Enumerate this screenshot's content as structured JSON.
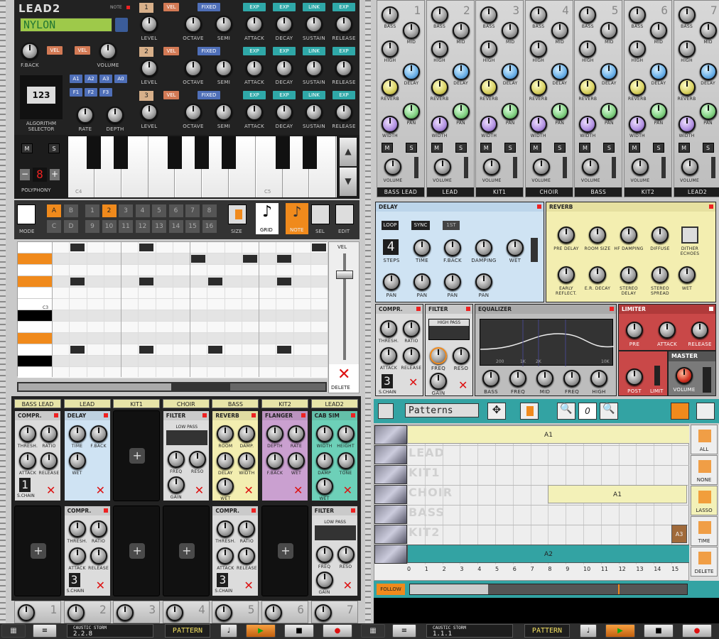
{
  "synth": {
    "name": "LEAD2",
    "note_label": "NOTE",
    "preset": "NYLON",
    "fback": "F.BACK",
    "vel": "VEL",
    "volume": "VOLUME",
    "algorithm": "ALGORITHM SELECTOR",
    "algo_display": "123",
    "rate": "RATE",
    "depth": "DEPTH",
    "lfo_buttons": [
      "A1",
      "A2",
      "A3",
      "A0",
      "F1",
      "F2",
      "F3"
    ],
    "operators": [
      {
        "num": "1"
      },
      {
        "num": "2"
      },
      {
        "num": "3"
      }
    ],
    "op_labels": {
      "level": "LEVEL",
      "octave": "OCTAVE",
      "semi": "SEMI",
      "attack": "ATTACK",
      "decay": "DECAY",
      "sustain": "SUSTAIN",
      "release": "RELEASE",
      "vel": "VEL",
      "fixed": "FIXED",
      "exp": "EXP",
      "link": "LINK"
    },
    "m": "M",
    "s": "S",
    "polyphony": "POLYPHONY",
    "poly_value": "8",
    "c4": "C4",
    "c5": "C5"
  },
  "pattern": {
    "banks": [
      "A",
      "B",
      "C",
      "D"
    ],
    "steps": [
      "1",
      "2",
      "3",
      "4",
      "5",
      "6",
      "7",
      "8",
      "9",
      "10",
      "11",
      "12",
      "13",
      "14",
      "15",
      "16"
    ],
    "size": "SIZE",
    "grid": "GRID",
    "note": "NOTE",
    "sel": "SEL",
    "edit": "EDIT",
    "mode": "MODE",
    "vel": "VEL",
    "c3": "C3",
    "delete": "DELETE"
  },
  "channels": [
    "BASS LEAD",
    "LEAD",
    "KIT1",
    "CHOIR",
    "BASS",
    "KIT2",
    "LEAD2"
  ],
  "fx_row1": [
    {
      "title": "COMPR.",
      "k": [
        "THRESH.",
        "RATIO",
        "ATTACK",
        "RELEASE"
      ],
      "extra": "S.CHAIN",
      "val": "1"
    },
    {
      "title": "DELAY",
      "k": [
        "TIME",
        "F.BACK",
        "WET"
      ]
    },
    {
      "title": ""
    },
    {
      "title": "FILTER",
      "mode": "LOW PASS",
      "k": [
        "FREQ",
        "RESO",
        "GAIN"
      ]
    },
    {
      "title": "REVERB",
      "k": [
        "ROOM",
        "DAMP.",
        "DELAY",
        "WIDTH",
        "WET"
      ]
    },
    {
      "title": "FLANGER",
      "k": [
        "DEPTH",
        "RATE",
        "F.BACK",
        "WET"
      ]
    },
    {
      "title": "CAB SIM",
      "k": [
        "WIDTH",
        "HEIGHT",
        "DAMP",
        "TONE",
        "WET"
      ]
    }
  ],
  "fx_row2": [
    {
      "title": ""
    },
    {
      "title": "COMPR.",
      "k": [
        "THRESH.",
        "RATIO",
        "ATTACK",
        "RELEASE"
      ],
      "extra": "S.CHAIN",
      "val": "3"
    },
    {
      "title": ""
    },
    {
      "title": ""
    },
    {
      "title": "COMPR.",
      "k": [
        "THRESH.",
        "RATIO",
        "ATTACK",
        "RELEASE"
      ],
      "extra": "S.CHAIN",
      "val": "3"
    },
    {
      "title": ""
    },
    {
      "title": "FILTER",
      "mode": "LOW PASS",
      "k": [
        "FREQ",
        "RESO",
        "GAIN"
      ]
    }
  ],
  "bottom_strip_nums": [
    "1",
    "2",
    "3",
    "4",
    "5",
    "6",
    "7"
  ],
  "mixer": {
    "channels": [
      {
        "num": "1",
        "name": "BASS LEAD"
      },
      {
        "num": "2",
        "name": "LEAD"
      },
      {
        "num": "3",
        "name": "KIT1"
      },
      {
        "num": "4",
        "name": "CHOIR"
      },
      {
        "num": "5",
        "name": "BASS"
      },
      {
        "num": "6",
        "name": "KIT2"
      },
      {
        "num": "7",
        "name": "LEAD2"
      }
    ],
    "labels": {
      "bass": "BASS",
      "mid": "MID",
      "high": "HIGH",
      "delay": "DELAY",
      "reverb": "REVERB",
      "pan": "PAN",
      "width": "WIDTH",
      "volume": "VOLUME",
      "m": "M",
      "s": "S"
    }
  },
  "delay": {
    "title": "DELAY",
    "loop": "LOOP",
    "sync": "SYNC",
    "first": "1ST",
    "steps_val": "4",
    "steps": "STEPS",
    "time": "TIME",
    "fback": "F.BACK",
    "damping": "DAMPING",
    "wet": "WET",
    "pan": "PAN"
  },
  "reverb": {
    "title": "REVERB",
    "k": [
      "PRE DELAY",
      "ROOM SIZE",
      "HF DAMPING",
      "DIFFUSE",
      "DITHER ECHOES"
    ],
    "k2": [
      "EARLY REFLECT.",
      "E.R. DECAY",
      "STEREO DELAY",
      "STEREO SPREAD",
      "WET"
    ]
  },
  "compr": {
    "title": "COMPR.",
    "thresh": "THRESH.",
    "ratio": "RATIO",
    "attack": "ATTACK",
    "release": "RELEASE",
    "schain": "S.CHAIN",
    "val": "3"
  },
  "filter": {
    "title": "FILTER",
    "mode": "HIGH PASS",
    "freq": "FREQ",
    "reso": "RESO",
    "gain": "GAIN"
  },
  "eq": {
    "title": "EQUALIZER",
    "freqs": [
      "200",
      "1K",
      "2K",
      "10K"
    ],
    "k": [
      "BASS",
      "FREQ",
      "MID",
      "FREQ",
      "HIGH"
    ]
  },
  "limiter": {
    "title": "LIMITER",
    "pre": "PRE",
    "attack": "ATTACK",
    "release": "RELEASE",
    "post": "POST",
    "limit": "LIMIT"
  },
  "master": {
    "title": "MASTER",
    "volume": "VOLUME"
  },
  "sequencer": {
    "mode": "Patterns",
    "zoom": "0",
    "tracks": [
      "LEAD",
      "KIT1",
      "CHOIR",
      "BASS",
      "KIT2"
    ],
    "clips": {
      "top": "A1",
      "choir": "A1",
      "kit2": "A3",
      "bottom": "A2"
    },
    "ruler": [
      "0",
      "1",
      "2",
      "3",
      "4",
      "5",
      "6",
      "7",
      "8",
      "9",
      "10",
      "11",
      "12",
      "13",
      "14",
      "15"
    ],
    "side": [
      "ALL",
      "NONE",
      "LASSO",
      "TIME",
      "DELETE"
    ],
    "follow": "FOLLOW"
  },
  "transport": [
    {
      "song": "CAUSTIC STORM",
      "pos": "2.2.8",
      "mode": "PATTERN"
    },
    {
      "song": "CAUSTIC STORM",
      "pos": "1.1.1",
      "mode": "PATTERN"
    }
  ],
  "colors": {
    "lcd_green": "#9ec94a",
    "accent_orange": "#f08a1c",
    "clip_yellow": "#f3f1b8",
    "clip_teal": "#33a3a3",
    "led_red": "#e22222"
  }
}
